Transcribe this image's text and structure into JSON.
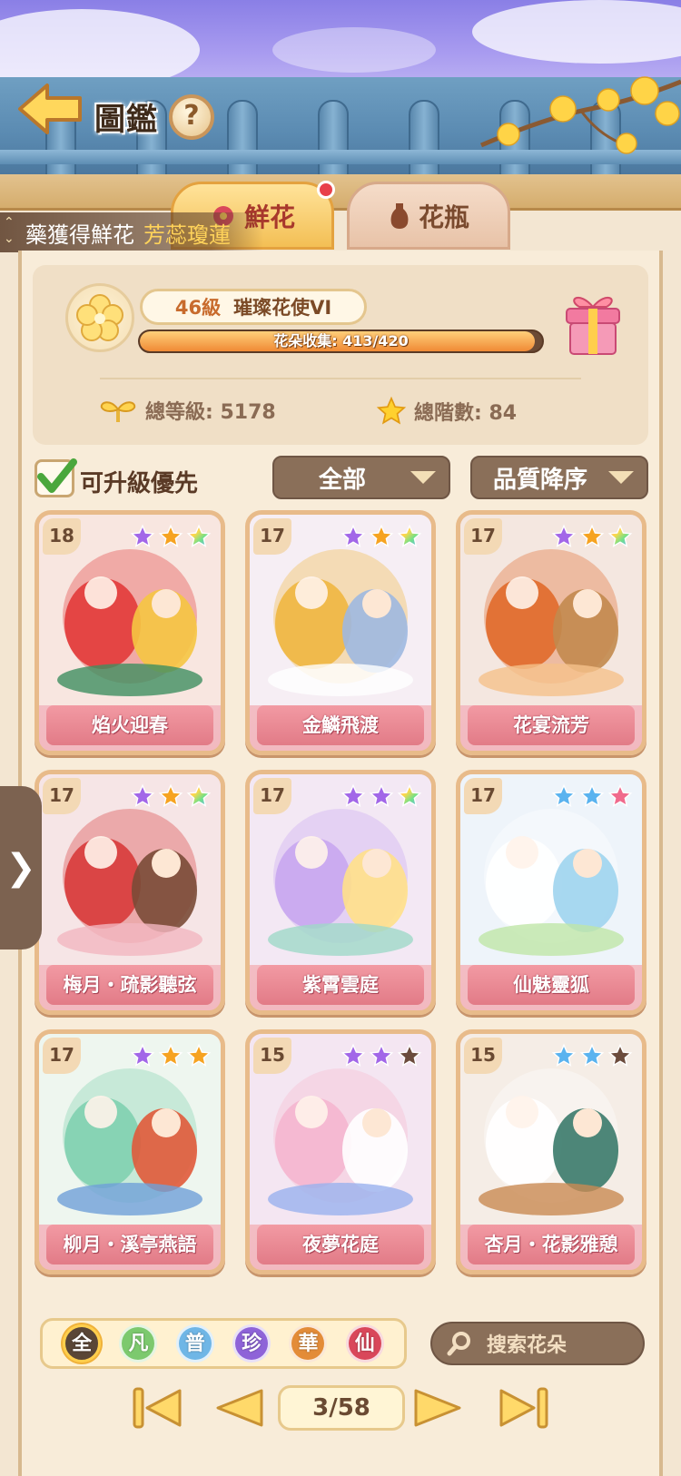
{
  "header": {
    "title": "圖鑑",
    "help": "?"
  },
  "tabs": [
    {
      "label": "鮮花",
      "active": true,
      "badge": true
    },
    {
      "label": "花瓶",
      "active": false
    }
  ],
  "marquee": {
    "text": "藥獲得鮮花",
    "highlight": "芳蕊瓊蓮"
  },
  "profile": {
    "level": "46級",
    "rank": "璀璨花使VI",
    "collection_text": "花朵收集: 413/420",
    "collection_progress": 0.983,
    "total_level": "總等級: 5178",
    "total_stars": "總階數: 84"
  },
  "filters": {
    "upgrade_first": "可升級優先",
    "upgrade_first_checked": true,
    "category": "全部",
    "sort": "品質降序"
  },
  "cards": [
    {
      "name": "焰火迎春",
      "level": "18",
      "stars": [
        "purple",
        "orange",
        "rainbow"
      ],
      "art": "lion"
    },
    {
      "name": "金鱗飛渡",
      "level": "17",
      "stars": [
        "purple",
        "orange",
        "rainbow"
      ],
      "art": "fish"
    },
    {
      "name": "花宴流芳",
      "level": "17",
      "stars": [
        "purple",
        "orange",
        "rainbow"
      ],
      "art": "feast"
    },
    {
      "name": "梅月・疏影聽弦",
      "level": "17",
      "stars": [
        "purple",
        "orange",
        "rainbow"
      ],
      "art": "plum"
    },
    {
      "name": "紫霄雲庭",
      "level": "17",
      "stars": [
        "purple",
        "purple",
        "rainbow"
      ],
      "art": "palace"
    },
    {
      "name": "仙魅靈狐",
      "level": "17",
      "stars": [
        "blue",
        "blue",
        "pink"
      ],
      "art": "fox"
    },
    {
      "name": "柳月・溪亭燕語",
      "level": "17",
      "stars": [
        "purple",
        "orange",
        "orange"
      ],
      "art": "willow"
    },
    {
      "name": "夜夢花庭",
      "level": "15",
      "stars": [
        "purple",
        "purple",
        "dark"
      ],
      "art": "rabbit"
    },
    {
      "name": "杏月・花影雅憩",
      "level": "15",
      "stars": [
        "blue",
        "blue",
        "dark"
      ],
      "art": "apricot"
    }
  ],
  "rarity_filters": [
    {
      "label": "全",
      "color": "#5a4636",
      "active": true
    },
    {
      "label": "凡",
      "color": "#7cc96e"
    },
    {
      "label": "普",
      "color": "#6fb6e6"
    },
    {
      "label": "珍",
      "color": "#8e63d8"
    },
    {
      "label": "華",
      "color": "#e38c38"
    },
    {
      "label": "仙",
      "color": "#d9475a"
    }
  ],
  "search": {
    "placeholder": "搜索花朵"
  },
  "pagination": {
    "current": "3/58"
  },
  "colors": {
    "star_purple": "#a267e8",
    "star_orange": "#f6a321",
    "star_blue": "#5ab3ef",
    "star_pink": "#f06a8c",
    "star_dark": "#6b4b3c",
    "card_name_bg": "#e27b87"
  }
}
